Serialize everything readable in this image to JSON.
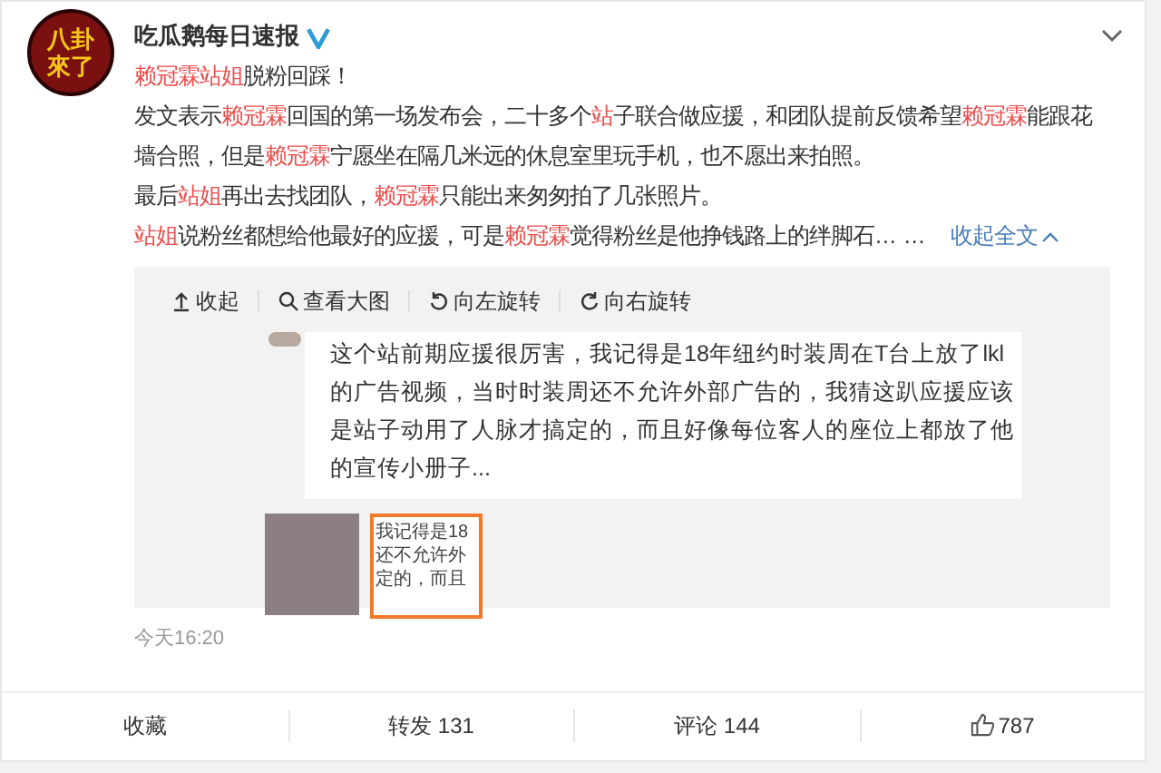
{
  "post": {
    "avatar_text": [
      "八卦",
      "來了"
    ],
    "author": "吃瓜鹅每日速报",
    "verified": true,
    "paragraphs": [
      [
        {
          "kind": "mention",
          "text": "赖冠霖站姐"
        },
        {
          "kind": "plain",
          "text": "脱粉回踩！"
        }
      ],
      [
        {
          "kind": "plain",
          "text": "发文表示"
        },
        {
          "kind": "mention",
          "text": "赖冠霖"
        },
        {
          "kind": "plain",
          "text": "回国的第一场发布会，二十多个"
        },
        {
          "kind": "mention",
          "text": "站"
        },
        {
          "kind": "plain",
          "text": "子联合做应援，和团队提前反馈希望"
        },
        {
          "kind": "mention",
          "text": "赖冠霖"
        },
        {
          "kind": "plain",
          "text": "能跟花墙合照，但是"
        },
        {
          "kind": "mention",
          "text": "赖冠霖"
        },
        {
          "kind": "plain",
          "text": "宁愿坐在隔几米远的休息室里玩手机，也不愿出来拍照。"
        }
      ],
      [
        {
          "kind": "plain",
          "text": "最后"
        },
        {
          "kind": "mention",
          "text": "站姐"
        },
        {
          "kind": "plain",
          "text": "再出去找团队，"
        },
        {
          "kind": "mention",
          "text": "赖冠霖"
        },
        {
          "kind": "plain",
          "text": "只能出来匆匆拍了几张照片。"
        }
      ],
      [
        {
          "kind": "mention",
          "text": "站姐"
        },
        {
          "kind": "plain",
          "text": "说粉丝都想给他最好的应援，可是"
        },
        {
          "kind": "mention",
          "text": "赖冠霖"
        },
        {
          "kind": "plain",
          "text": "觉得粉丝是他挣钱路上的绊脚石… …"
        }
      ]
    ],
    "collapse_link": "收起全文",
    "media": {
      "tools": [
        {
          "kind": "up",
          "label": "收起"
        },
        {
          "kind": "zoom",
          "label": "查看大图"
        },
        {
          "kind": "rotate-left",
          "label": "向左旋转"
        },
        {
          "kind": "rotate-right",
          "label": "向右旋转"
        }
      ],
      "image_text": "这个站前期应援很厉害，我记得是18年纽约时装周在T台上放了lkl的广告视频，当时时装周还不允许外部广告的，我猜这趴应援应该是站子动用了人脉才搞定的，而且好像每位客人的座位上都放了他的宣传小册子...",
      "thumbnails": [
        {
          "kind": "photo",
          "selected": false
        },
        {
          "kind": "text",
          "selected": true,
          "lines": [
            "我记得是18",
            "还不允许外",
            "定的，而且"
          ]
        }
      ]
    },
    "time": "今天16:20",
    "actions": [
      {
        "kind": "text",
        "label": "收藏"
      },
      {
        "kind": "text",
        "label": "转发 131"
      },
      {
        "kind": "text",
        "label": "评论 144"
      },
      {
        "kind": "like",
        "label": "787"
      }
    ]
  }
}
